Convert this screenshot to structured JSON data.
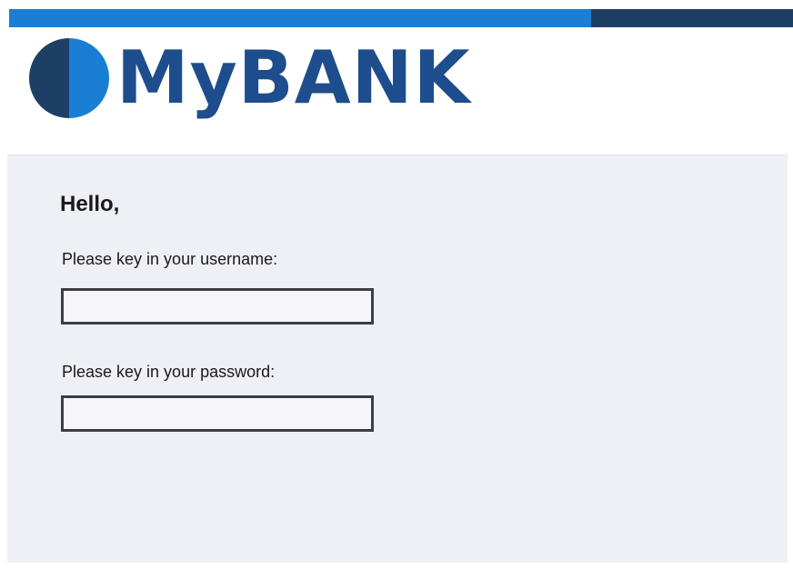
{
  "brand": {
    "name": "MyBANK",
    "logo_icon": "half-circle-logo-icon",
    "colors": {
      "primary_blue": "#1a7fd4",
      "dark_navy": "#1d3f66",
      "wordmark": "#1d4d8c"
    }
  },
  "login": {
    "greeting": "Hello,",
    "username_label": "Please key in your username:",
    "username_value": "",
    "password_label": "Please key in your password:",
    "password_value": ""
  }
}
